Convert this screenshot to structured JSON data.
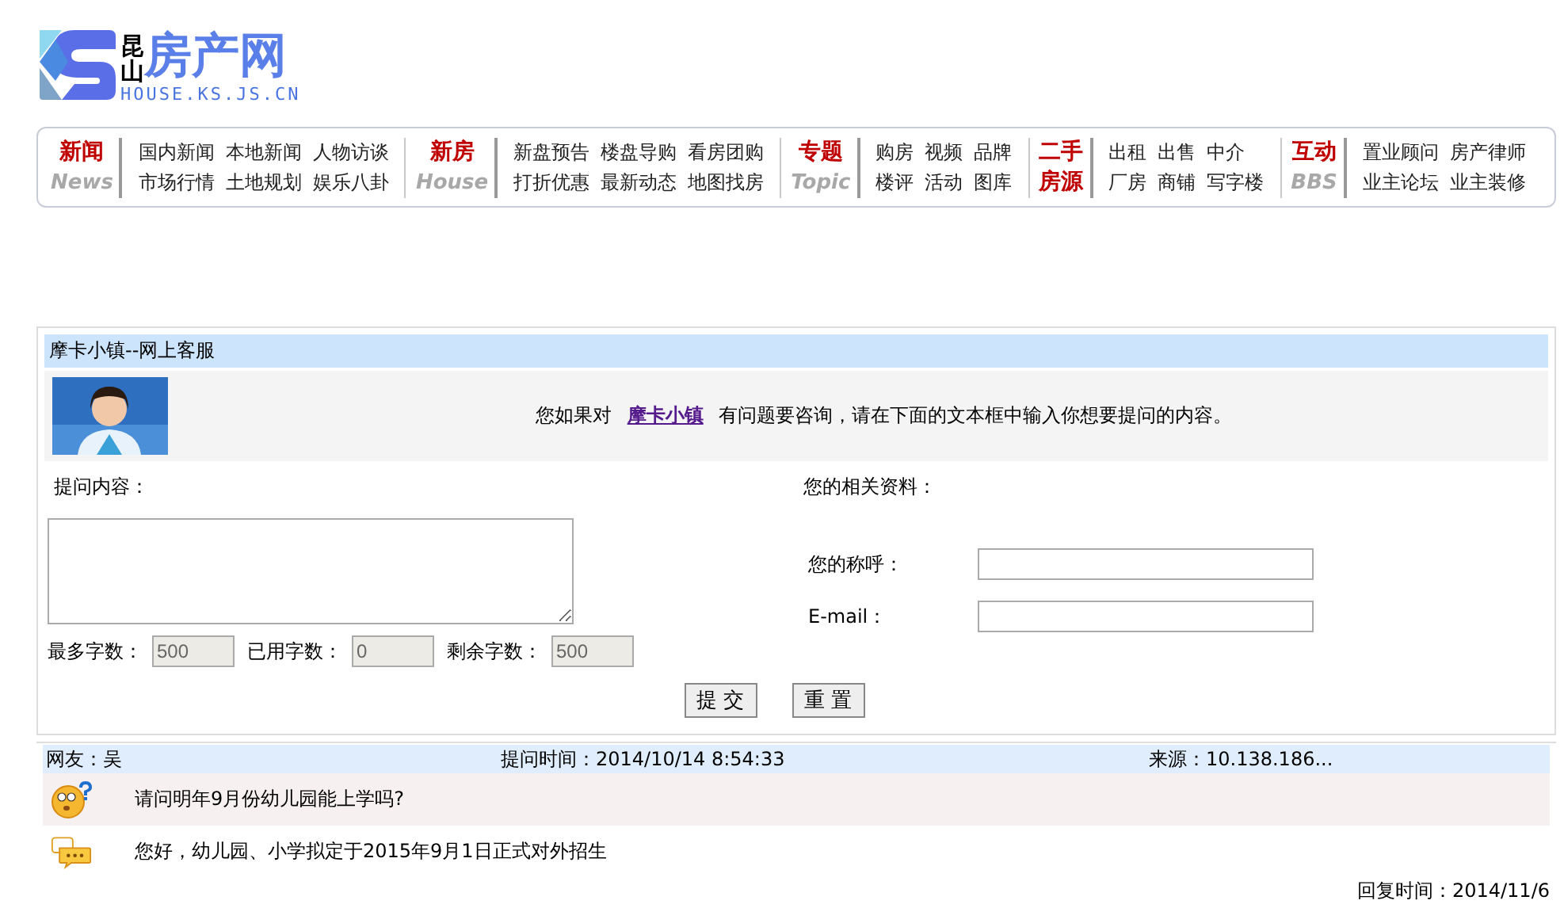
{
  "logo": {
    "top": "昆",
    "bottom": "山",
    "name": "房产网",
    "url": "HOUSE.KS.JS.CN"
  },
  "nav": [
    {
      "kind": "bilingual",
      "title": "新闻",
      "subtitle": "News",
      "links": [
        [
          "国内新闻",
          "本地新闻",
          "人物访谈"
        ],
        [
          "市场行情",
          "土地规划",
          "娱乐八卦"
        ]
      ]
    },
    {
      "kind": "bilingual",
      "title": "新房",
      "subtitle": "House",
      "links": [
        [
          "新盘预告",
          "楼盘导购",
          "看房团购"
        ],
        [
          "打折优惠",
          "最新动态",
          "地图找房"
        ]
      ]
    },
    {
      "kind": "bilingual",
      "title": "专题",
      "subtitle": "Topic",
      "links": [
        [
          "购房",
          "视频",
          "品牌"
        ],
        [
          "楼评",
          "活动",
          "图库"
        ]
      ]
    },
    {
      "kind": "stacked",
      "title": "二手",
      "subtitle": "房源",
      "links": [
        [
          "出租",
          "出售",
          "中介"
        ],
        [
          "厂房",
          "商铺",
          "写字楼"
        ]
      ]
    },
    {
      "kind": "bilingual",
      "title": "互动",
      "subtitle": "BBS",
      "links": [
        [
          "置业顾问",
          "房产律师"
        ],
        [
          "业主论坛",
          "业主装修"
        ]
      ]
    }
  ],
  "service": {
    "title": "摩卡小镇--网上客服",
    "intro_before": "您如果对",
    "intro_link": "摩卡小镇",
    "intro_after": "有问题要咨询，请在下面的文本框中输入你想要提问的内容。",
    "question_label": "提问内容：",
    "info_label": "您的相关资料：",
    "counters": [
      {
        "label": "最多字数：",
        "value": "500"
      },
      {
        "label": "已用字数：",
        "value": "0"
      },
      {
        "label": "剩余字数：",
        "value": "500"
      }
    ],
    "fields": [
      {
        "label": "您的称呼："
      },
      {
        "label": "E-mail："
      }
    ],
    "buttons": [
      "提 交",
      "重 置"
    ]
  },
  "qa": {
    "user": "网友：吴",
    "time": "提问时间：2014/10/14  8:54:33",
    "source": "来源：10.138.186...",
    "question": "请问明年9月份幼儿园能上学吗?",
    "answer": "您好，幼儿园、小学拟定于2015年9月1日正式对外招生",
    "reply_time": "回复时间：2014/11/6"
  }
}
